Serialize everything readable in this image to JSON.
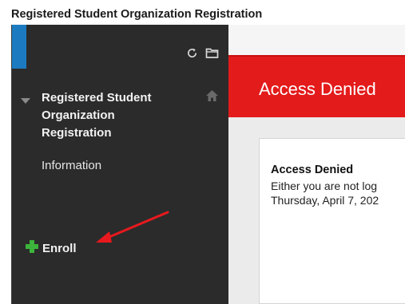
{
  "page": {
    "heading": "Registered Student Organization Registration"
  },
  "sidebar": {
    "toolbar_icons": [
      "refresh-icon",
      "folder-icon"
    ],
    "course": {
      "title": "Registered Student Organization Registration",
      "icon": "home-icon",
      "expander_icon": "caret-down-icon"
    },
    "menu_items": [
      {
        "label": "Information"
      }
    ],
    "enroll": {
      "label": "Enroll",
      "icon": "plus-icon",
      "icon_color": "#3cb43c"
    },
    "annotation": {
      "type": "arrow",
      "color": "#e8191e",
      "points_to": "enroll"
    }
  },
  "content": {
    "banner": {
      "title": "Access Denied",
      "color": "#e31b1b"
    },
    "message": {
      "title": "Access Denied",
      "line1": "Either you are not log",
      "line2": "Thursday, April 7, 202"
    }
  },
  "colors": {
    "sidebar_bg": "#2b2b2b",
    "accent": "#1c7bc0"
  }
}
